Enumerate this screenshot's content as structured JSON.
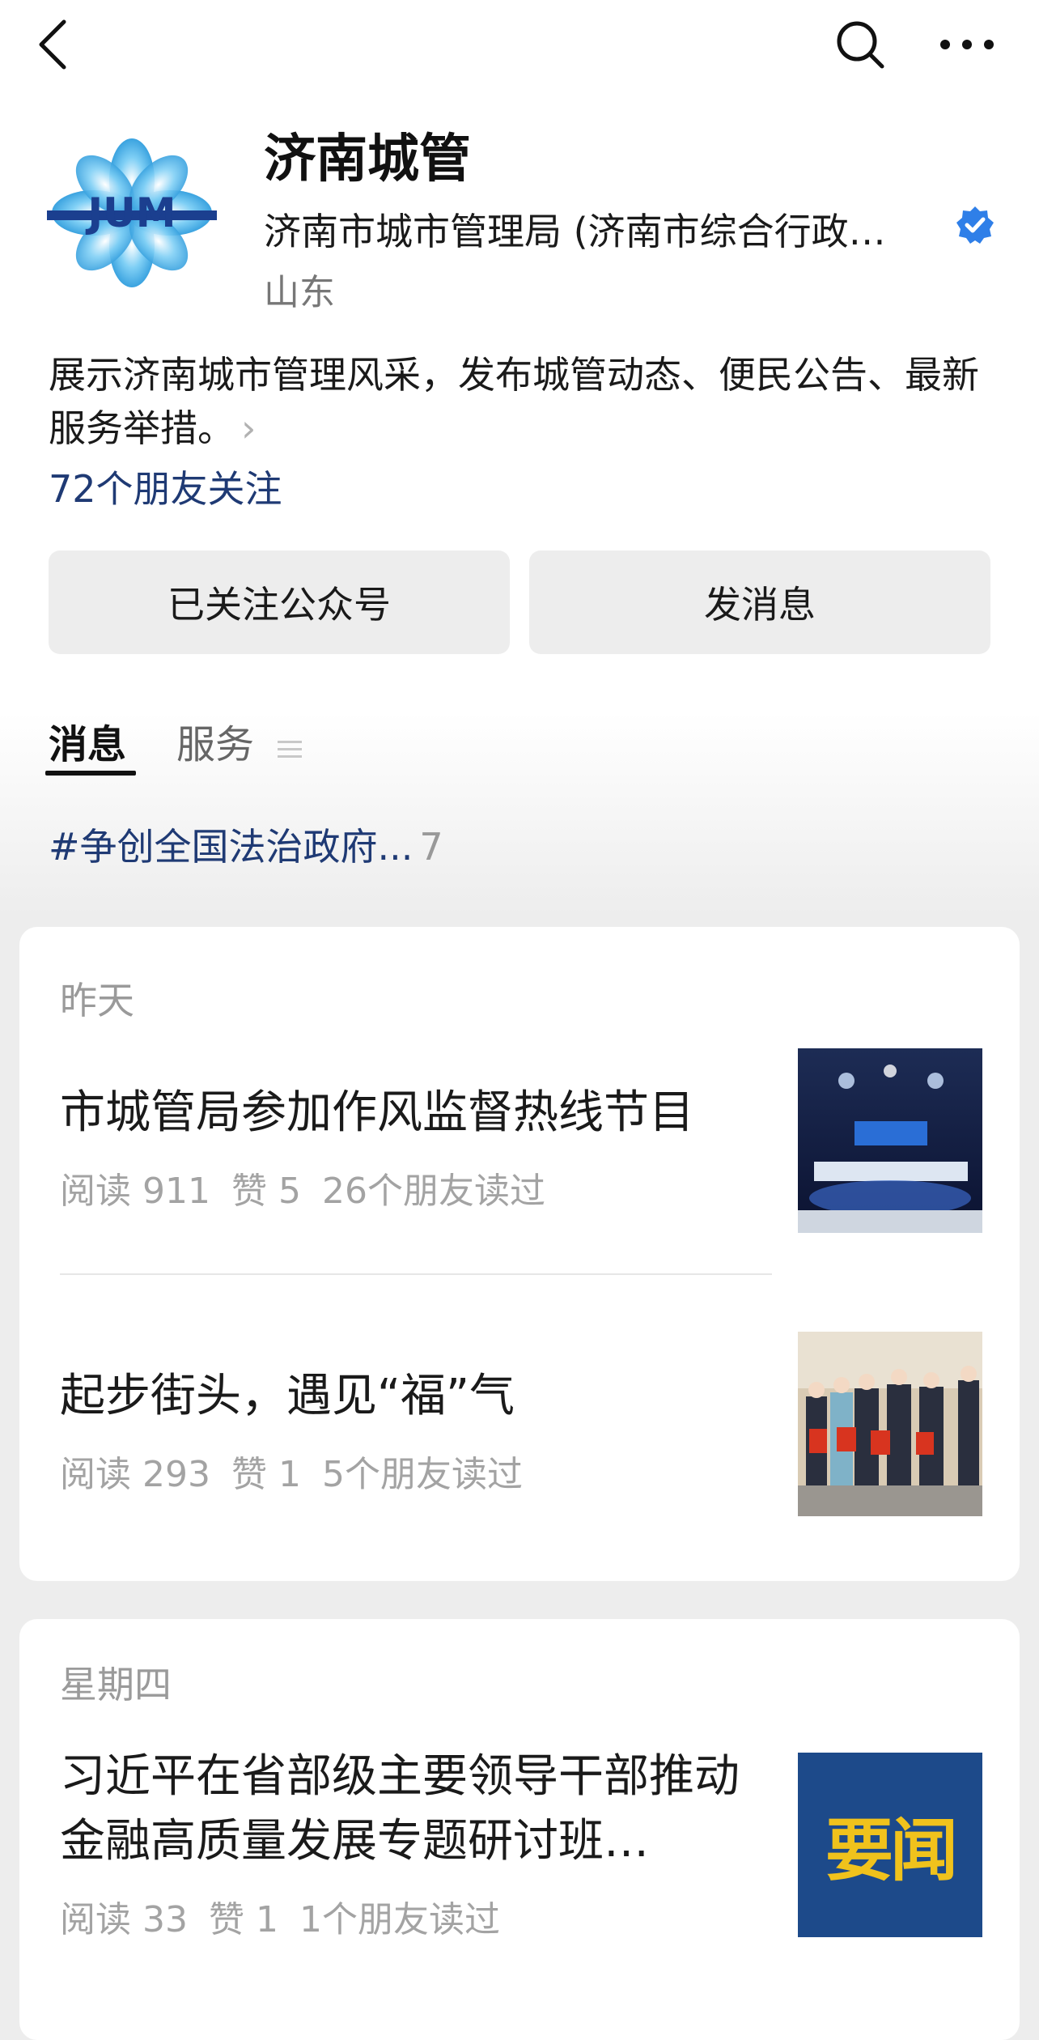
{
  "account": {
    "name": "济南城管",
    "full_name": "济南市城市管理局 (济南市综合行政…",
    "region": "山东",
    "description": "展示济南城市管理风采，发布城管动态、便民公告、最新服务举措。",
    "friends_following": "72个朋友关注",
    "logo_text": "JUM"
  },
  "actions": {
    "follow_label": "已关注公众号",
    "message_label": "发消息"
  },
  "tabs": [
    {
      "label": "消息",
      "active": true
    },
    {
      "label": "服务",
      "active": false
    }
  ],
  "topic": {
    "label": "#争创全国法治政府...",
    "count": "7"
  },
  "groups": [
    {
      "day": "昨天",
      "articles": [
        {
          "title": "市城管局参加作风监督热线节目",
          "reads": "阅读 911",
          "likes": "赞 5",
          "friends": "26个朋友读过",
          "thumb": "tv-studio-photo"
        },
        {
          "title": "起步街头，遇见“福”气",
          "reads": "阅读 293",
          "likes": "赞 1",
          "friends": "5个朋友读过",
          "thumb": "people-holding-fu-bags-photo"
        }
      ]
    },
    {
      "day": "星期四",
      "articles": [
        {
          "title": "习近平在省部级主要领导干部推动金融高质量发展专题研讨班…",
          "reads": "阅读 33",
          "likes": "赞 1",
          "friends": "1个朋友读过",
          "thumb": "yaowen-badge",
          "thumb_text": "要闻"
        }
      ]
    }
  ],
  "colors": {
    "link_blue": "#1f3a74",
    "verified_blue": "#2f7fe8",
    "yaowen_bg": "#1d4a8a",
    "yaowen_text": "#f0c21c"
  }
}
